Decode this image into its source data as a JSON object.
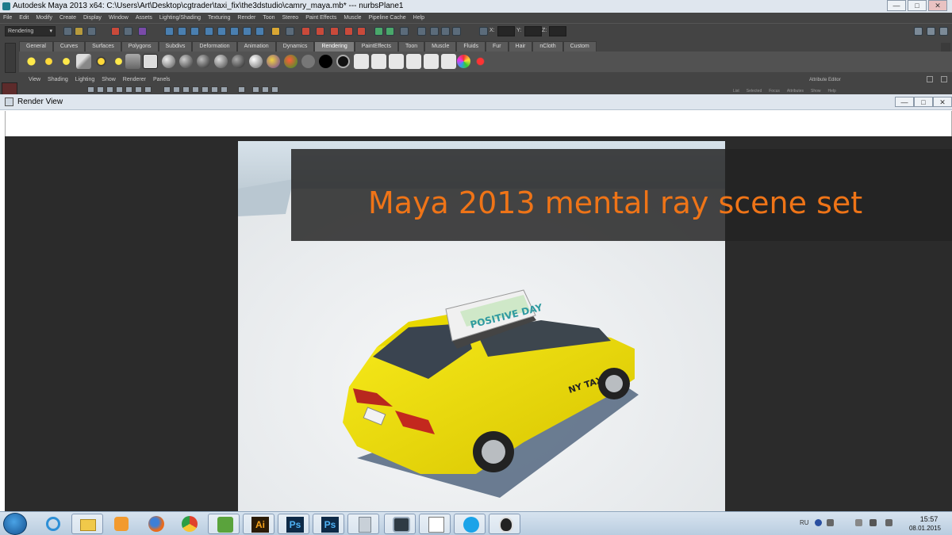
{
  "maya": {
    "window_title": "Autodesk Maya 2013 x64: C:\\Users\\Art\\Desktop\\cgtrader\\taxi_fix\\the3dstudio\\camry_maya.mb*  ---  nurbsPlane1",
    "menus": [
      "File",
      "Edit",
      "Modify",
      "Create",
      "Display",
      "Window",
      "Assets",
      "Lighting/Shading",
      "Texturing",
      "Render",
      "Toon",
      "Stereo",
      "Paint Effects",
      "Muscle",
      "Pipeline Cache",
      "Help"
    ],
    "mode": "Rendering",
    "coord_labels": [
      "X:",
      "Y:",
      "Z:"
    ],
    "shelf_tabs": [
      "General",
      "Curves",
      "Surfaces",
      "Polygons",
      "Subdivs",
      "Deformation",
      "Animation",
      "Dynamics",
      "Rendering",
      "PaintEffects",
      "Toon",
      "Muscle",
      "Fluids",
      "Fur",
      "Hair",
      "nCloth",
      "Custom"
    ],
    "active_shelf_tab": "Rendering",
    "panel_menus": [
      "View",
      "Shading",
      "Lighting",
      "Show",
      "Renderer",
      "Panels"
    ],
    "attribute_editor_label": "Attribute Editor",
    "attribute_editor_menus": [
      "List",
      "Selected",
      "Focus",
      "Attributes",
      "Show",
      "Help"
    ]
  },
  "render_view": {
    "title": "Render View",
    "banner_text": "Maya 2013 mental ray scene set",
    "taxi_sign": "POSITIVE DAY",
    "taxi_door_logo": "NY TAXI",
    "colors": {
      "banner_text": "#ef7417",
      "taxi_yellow": "#f2e100",
      "viewport_bg": "#2b2b2b",
      "ground": "#eef0f2"
    }
  },
  "taskbar": {
    "apps": [
      "internet-explorer",
      "file-explorer",
      "media-player",
      "firefox",
      "chrome",
      "green-app",
      "illustrator",
      "photoshop",
      "photoshop-2",
      "calculator",
      "maya",
      "notepad",
      "skype",
      "inkscape"
    ],
    "app_labels": {
      "illustrator": "Ai",
      "photoshop": "Ps",
      "photoshop-2": "Ps"
    },
    "language": "RU",
    "time": "15:57",
    "date": "08.01.2015"
  }
}
